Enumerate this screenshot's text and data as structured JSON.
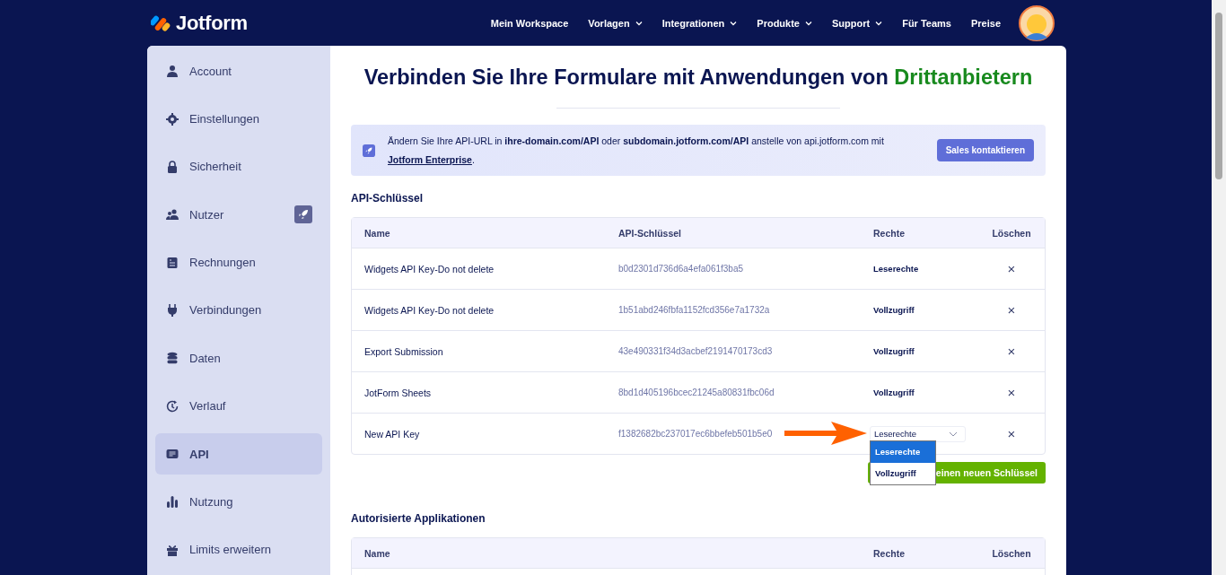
{
  "header": {
    "logo": "Jotform",
    "nav": [
      {
        "label": "Mein Workspace",
        "dropdown": false
      },
      {
        "label": "Vorlagen",
        "dropdown": true
      },
      {
        "label": "Integrationen",
        "dropdown": true
      },
      {
        "label": "Produkte",
        "dropdown": true
      },
      {
        "label": "Support",
        "dropdown": true
      },
      {
        "label": "Für Teams",
        "dropdown": false
      },
      {
        "label": "Preise",
        "dropdown": false
      }
    ]
  },
  "sidebar": {
    "items": [
      {
        "label": "Account",
        "selected": false,
        "upgrade_badge": false
      },
      {
        "label": "Einstellungen",
        "selected": false,
        "upgrade_badge": false
      },
      {
        "label": "Sicherheit",
        "selected": false,
        "upgrade_badge": false
      },
      {
        "label": "Nutzer",
        "selected": false,
        "upgrade_badge": true
      },
      {
        "label": "Rechnungen",
        "selected": false,
        "upgrade_badge": false
      },
      {
        "label": "Verbindungen",
        "selected": false,
        "upgrade_badge": false
      },
      {
        "label": "Daten",
        "selected": false,
        "upgrade_badge": false
      },
      {
        "label": "Verlauf",
        "selected": false,
        "upgrade_badge": false
      },
      {
        "label": "API",
        "selected": true,
        "upgrade_badge": false
      },
      {
        "label": "Nutzung",
        "selected": false,
        "upgrade_badge": false
      },
      {
        "label": "Limits erweitern",
        "selected": false,
        "upgrade_badge": false
      }
    ]
  },
  "main": {
    "title": "Verbinden Sie Ihre Formulare mit Anwendungen von",
    "title_highlight": "Drittanbietern",
    "banner": {
      "text": "Ändern Sie Ihre API-URL in **ihre-domain.com/API** oder **subdomain.jotform.com/API** anstelle von api.jotform.com mit",
      "link": "Jotform Enterprise",
      "text_after": ".",
      "button": "Sales kontaktieren"
    },
    "api_keys": {
      "heading": "API-Schlüssel",
      "columns": [
        "Name",
        "API-Schlüssel",
        "Rechte",
        "Löschen"
      ],
      "rows": [
        {
          "name": "Widgets API Key-Do not delete",
          "key": "b0d2301d736d6a4efa061f3ba5",
          "rights": "Leserechte",
          "kind": "text",
          "delete": "×"
        },
        {
          "name": "Widgets API Key-Do not delete",
          "key": "1b51abd246fbfa1152fcd356e7a1732a",
          "rights": "Vollzugriff",
          "kind": "text",
          "delete": "×"
        },
        {
          "name": "Export Submission",
          "key": "43e490331f34d3acbef2191470173cd3",
          "rights": "Vollzugriff",
          "kind": "text",
          "delete": "×"
        },
        {
          "name": "JotForm Sheets",
          "key": "8bd1d405196bcec21245a80831fbc06d",
          "rights": "Vollzugriff",
          "kind": "text",
          "delete": "×"
        },
        {
          "name": "New API Key",
          "key": "f1382682bc237017ec6bbefeb501b5e0",
          "rights": "Leserechte",
          "kind": "select",
          "expanded": true,
          "options": [
            {
              "label": "Leserechte",
              "selected": true
            },
            {
              "label": "Vollzugriff",
              "selected": false
            }
          ],
          "delete": "×"
        }
      ],
      "create_button": "einen neuen Schlüssel"
    },
    "authorized_apps": {
      "heading": "Autorisierte Applikationen",
      "columns": [
        "Name",
        "Rechte",
        "Löschen"
      ]
    }
  }
}
